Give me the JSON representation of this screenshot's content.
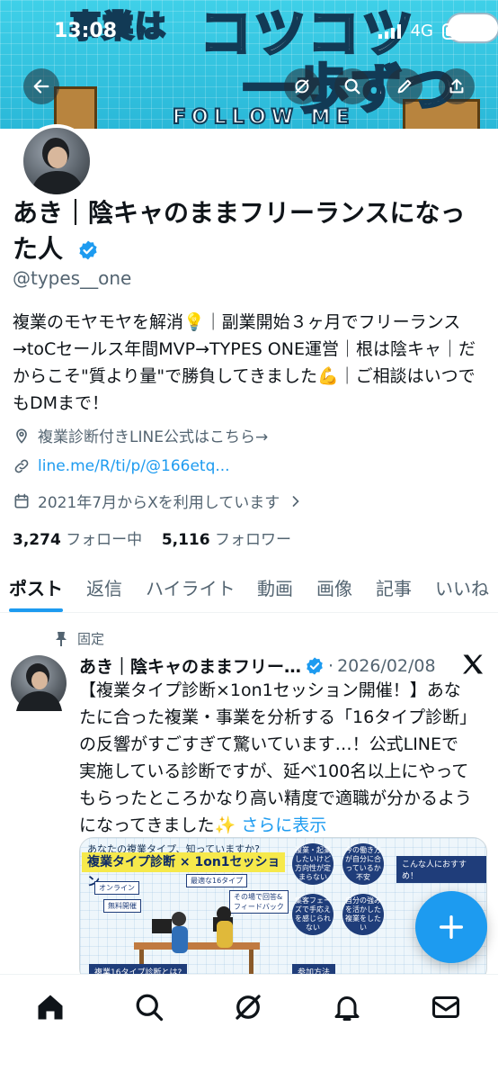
{
  "status_bar": {
    "time": "13:08",
    "network": "4G"
  },
  "banner": {
    "text_small": "事業は",
    "text_big": "コツコツ",
    "text_big2": "一歩ずつ",
    "follow_text": "FOLLOW ME"
  },
  "profile": {
    "name": "あき｜陰キャのままフリーランスになった人",
    "handle": "@types__one",
    "bio": "複業のモヤモヤを解消💡｜副業開始３ヶ月でフリーランス→toCセールス年間MVP→TYPES ONE運営｜根は陰キャ｜だからこそ\"質より量\"で勝負してきました💪｜ご相談はいつでもDMまで！",
    "location": "複業診断付きLINE公式はこちら→",
    "website": "line.me/R/ti/p/@166etq...",
    "joined": "2021年7月からXを利用しています",
    "following_count": "3,274",
    "following_label": "フォロー中",
    "followers_count": "5,116",
    "followers_label": "フォロワー"
  },
  "tabs": [
    "ポスト",
    "返信",
    "ハイライト",
    "動画",
    "画像",
    "記事",
    "いいね"
  ],
  "tweet": {
    "pinned_label": "固定",
    "author_name": "あき｜陰キャのままフリー…",
    "date": "2026/02/08",
    "body": "【複業タイプ診断×1on1セッション開催！】あなたに合った複業・事業を分析する「16タイプ診断」の反響がすごすぎて驚いています…！公式LINEで実施している診断ですが、延べ100名以上にやってもらったところかなり高い精度で適職が分かるようになってきました✨",
    "show_more": "さらに表示",
    "media": {
      "question": "あなたの複業タイプ、知っていますか?",
      "title": "複業タイプ診断 × 1on1セッション",
      "tag_online": "オンライン",
      "tag_free": "無料開催",
      "tag_16": "最適な16タイプ",
      "tag_feedback": "その場で回答&フィードバック",
      "bubble1": "複業・起業したいけど方向性が定まらない",
      "bubble2": "今の働き方が自分に合っているか不安",
      "bubble3": "集客フェーズで手応えを感じられない",
      "bubble4": "自分の強みを活かした複業をしたい",
      "recommend": "こんな人におすすめ！",
      "footer_left": "複業16タイプ診断とは?",
      "footer_right": "参加方法"
    }
  },
  "colors": {
    "accent": "#1d9bf0",
    "text": "#0f1419",
    "muted": "#536471",
    "banner": "#3fd0e8"
  }
}
